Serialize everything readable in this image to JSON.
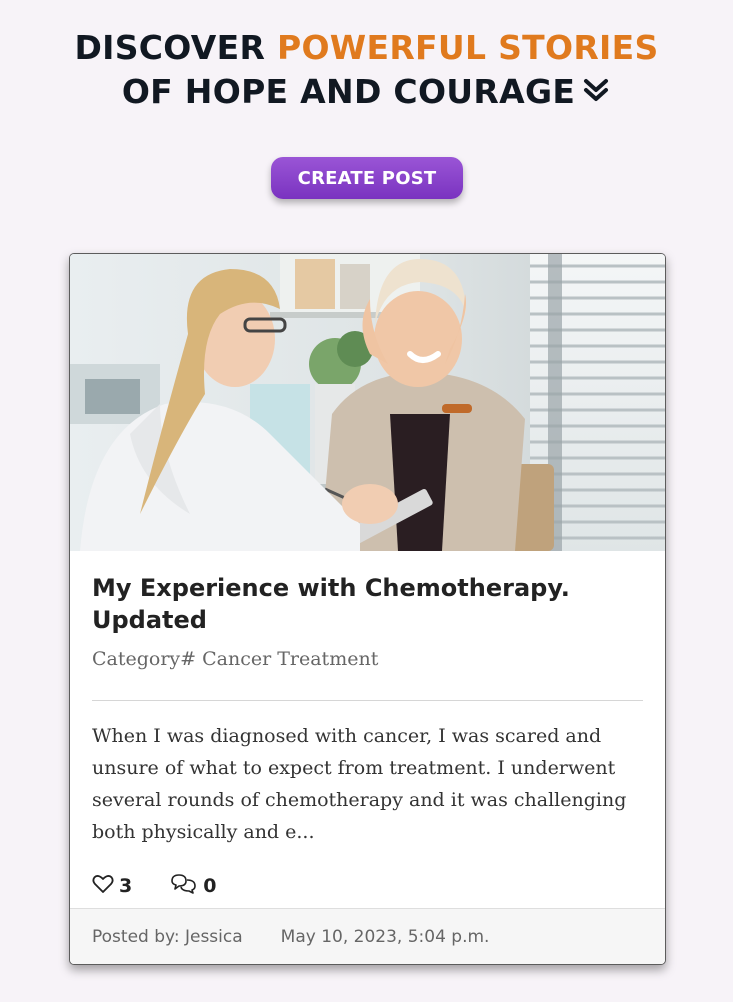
{
  "hero": {
    "line1_prefix": "DISCOVER",
    "line1_accent": "POWERFUL STORIES",
    "line2": "OF HOPE AND COURAGE",
    "chevron_icon": "double-chevron-down-icon",
    "accent_color": "#e07a1e"
  },
  "actions": {
    "create_post_label": "CREATE POST",
    "button_color": "#8a44cc"
  },
  "post": {
    "image_alt": "Doctor consulting a smiling cancer patient wearing a headscarf",
    "title": "My Experience with Chemotherapy. Updated",
    "category": "Category# Cancer Treatment",
    "excerpt": "When I was diagnosed with cancer, I was scared and unsure of what to expect from treatment. I underwent several rounds of chemotherapy and it was challenging both physically and e...",
    "likes": "3",
    "like_icon": "heart-icon",
    "comments": "0",
    "comment_icon": "comments-icon",
    "posted_by": "Posted by: Jessica",
    "posted_at": "May 10, 2023, 5:04 p.m."
  }
}
